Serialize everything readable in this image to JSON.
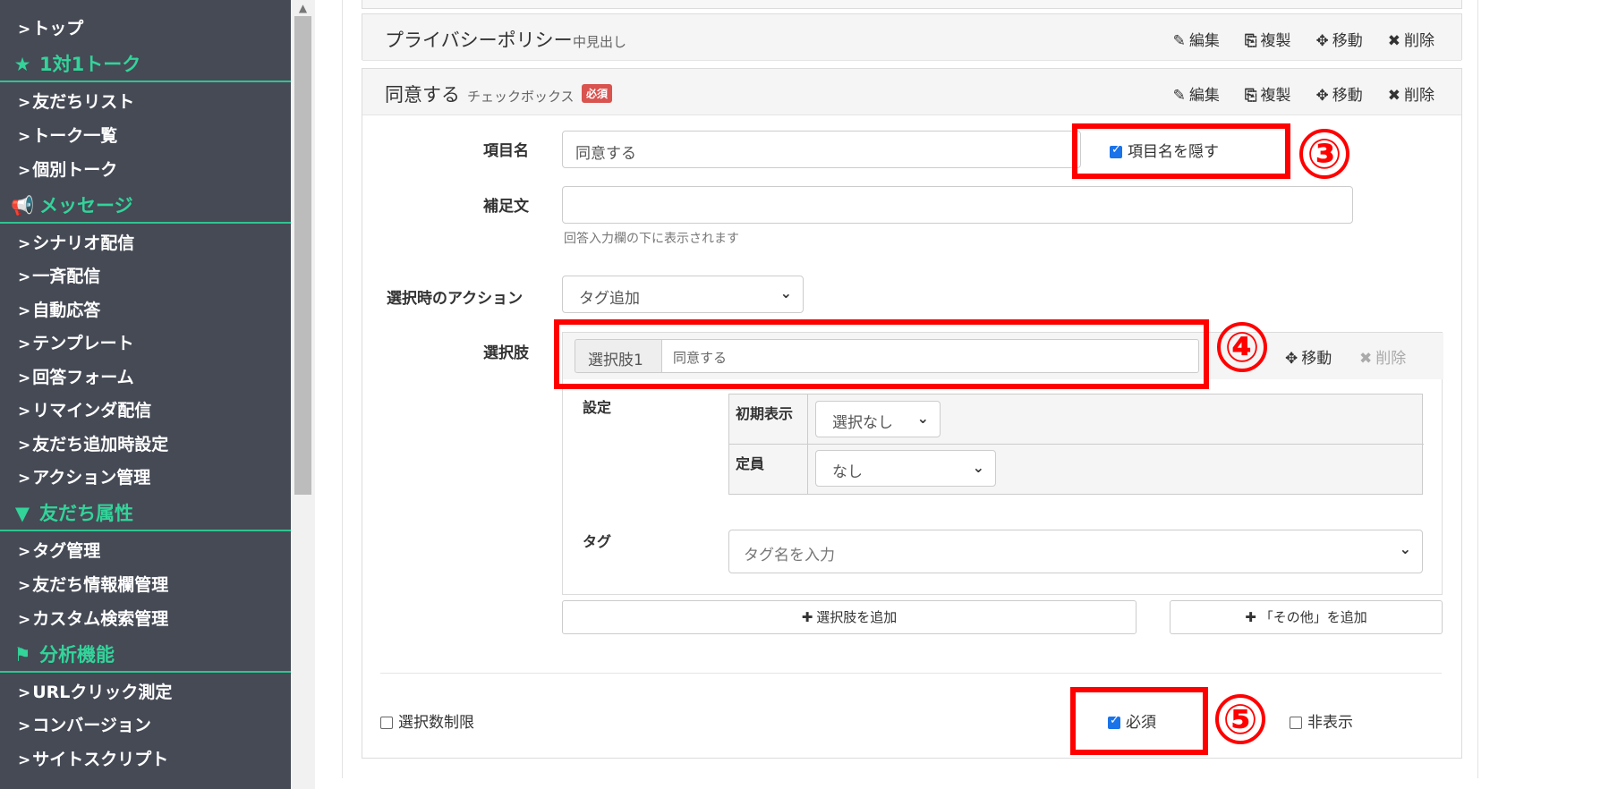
{
  "sidebar": {
    "items": [
      {
        "label": "トップ"
      },
      {
        "label": "友だちリスト"
      },
      {
        "label": "トーク一覧"
      },
      {
        "label": "個別トーク"
      },
      {
        "label": "シナリオ配信"
      },
      {
        "label": "一斉配信"
      },
      {
        "label": "自動応答"
      },
      {
        "label": "テンプレート"
      },
      {
        "label": "回答フォーム"
      },
      {
        "label": "リマインダ配信"
      },
      {
        "label": "友だち追加時設定"
      },
      {
        "label": "アクション管理"
      },
      {
        "label": "タグ管理"
      },
      {
        "label": "友だち情報欄管理"
      },
      {
        "label": "カスタム検索管理"
      },
      {
        "label": "URLクリック測定"
      },
      {
        "label": "コンバージョン"
      },
      {
        "label": "サイトスクリプト"
      }
    ],
    "headings": [
      {
        "label": "1対1トーク",
        "icon": "star-icon"
      },
      {
        "label": "メッセージ",
        "icon": "megaphone-icon"
      },
      {
        "label": "友だち属性",
        "icon": "filter-icon"
      },
      {
        "label": "分析機能",
        "icon": "flag-icon"
      }
    ],
    "accent_color": "#33d39a"
  },
  "blocks": {
    "privacy": {
      "title": "プライバシーポリシー",
      "type": "中見出し"
    },
    "agree": {
      "title": "同意する",
      "type": "チェックボックス",
      "badge": "必須"
    },
    "actions": {
      "edit": "編集",
      "copy": "複製",
      "move": "移動",
      "delete": "削除"
    }
  },
  "form": {
    "item_name_label": "項目名",
    "item_name_value": "同意する",
    "hide_label": "項目名を隠す",
    "supplement_label": "補足文",
    "supplement_help": "回答入力欄の下に表示されます",
    "action_label": "選択時のアクション",
    "action_value": "タグ追加",
    "choices_label": "選択肢",
    "choice_addon": "選択肢1",
    "choice_value": "同意する",
    "choice_move": "移動",
    "choice_delete": "削除",
    "settings_label": "設定",
    "initial_label": "初期表示",
    "initial_value": "選択なし",
    "capacity_label": "定員",
    "capacity_value": "なし",
    "tag_label": "タグ",
    "tag_placeholder": "タグ名を入力",
    "add_choice": "選択肢を追加",
    "add_other": "「その他」を追加",
    "limit_label": "選択数制限",
    "required_label": "必須",
    "hidden_label": "非表示"
  },
  "annotations": {
    "n3": "③",
    "n4": "④",
    "n5": "⑤",
    "color": "#ff0000"
  }
}
